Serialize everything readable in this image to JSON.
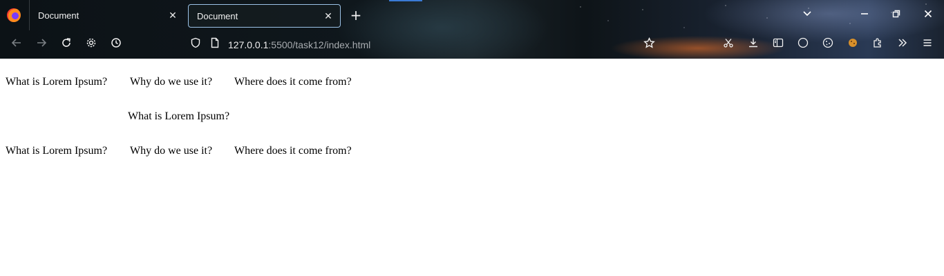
{
  "browser": {
    "tabs": [
      {
        "title": "Document",
        "active": false
      },
      {
        "title": "Document",
        "active": true
      }
    ],
    "new_tab_icon": "+",
    "close_icon": "✕",
    "url": {
      "host": "127.0.0.1",
      "path": ":5500/task12/index.html"
    },
    "window_controls": {
      "list_all_tabs": "⌄",
      "minimize": "—",
      "restore": "❐",
      "close": "✕"
    }
  },
  "page": {
    "nav_top": [
      "What is Lorem Ipsum?",
      "Why do we use it?",
      "Where does it come from?"
    ],
    "middle_heading": "What is Lorem Ipsum?",
    "nav_bottom": [
      "What is Lorem Ipsum?",
      "Why do we use it?",
      "Where does it come from?"
    ]
  }
}
